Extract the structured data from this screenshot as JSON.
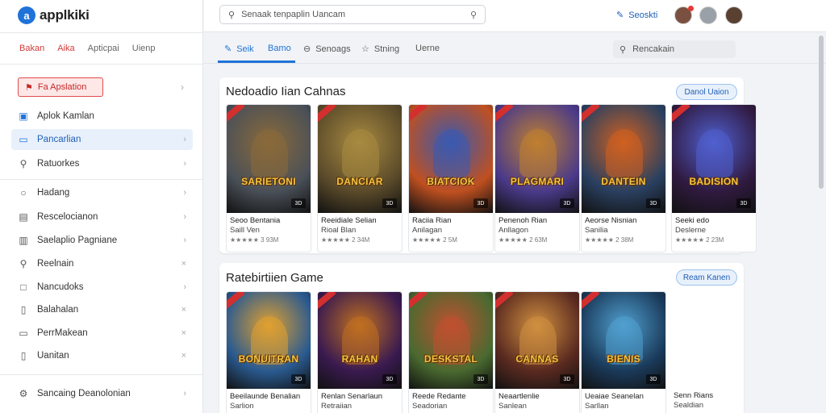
{
  "app": {
    "logo_text": "applkiki"
  },
  "sidebar": {
    "tabs": [
      "Bakan",
      "Aika",
      "Apticpai",
      "Uienp"
    ],
    "featured": {
      "label": "Fa Apslation"
    },
    "items": [
      {
        "label": "Aplok Kamlan",
        "icon": "app-window-icon"
      },
      {
        "label": "Pancarlian",
        "icon": "chat-bubble-icon"
      },
      {
        "label": "Ratuorkes",
        "icon": "search-icon"
      },
      {
        "label": "Hadang",
        "icon": "circle-icon"
      },
      {
        "label": "Rescelocianon",
        "icon": "calendar-icon"
      },
      {
        "label": "Saelaplio Pagniane",
        "icon": "sliders-icon"
      },
      {
        "label": "Reelnain",
        "icon": "magnifier-icon"
      },
      {
        "label": "Nancudoks",
        "icon": "square-icon"
      },
      {
        "label": "Balahalan",
        "icon": "bookmark-icon"
      },
      {
        "label": "PerrMakean",
        "icon": "folder-icon"
      },
      {
        "label": "Uanitan",
        "icon": "cube-icon"
      }
    ],
    "bottom_item": {
      "label": "Sancaing Deanolonian",
      "icon": "gear-icon"
    }
  },
  "topbar": {
    "search_text": "Senaak tenpaplin Uancam",
    "action_label": "Seoskti"
  },
  "content_tabs": [
    "Seik",
    "Bamo",
    "Senoags",
    "Stning",
    "Uerne"
  ],
  "sub_search": {
    "placeholder": "Rencakain"
  },
  "sections": [
    {
      "title": "Nedoadio Iian Cahnas",
      "button": "Danol Uaion",
      "cards": [
        {
          "cover_title": "SARIETONI",
          "name": "Seoo Bentania",
          "dev": "Saill Ven",
          "rating": "★★★★★ 3 93M",
          "badge": "3D",
          "bg": "#4a5058",
          "accent": "#8a6a3a"
        },
        {
          "cover_title": "DANCIAR",
          "name": "Reeidiale Selian",
          "dev": "Rioal Blan",
          "rating": "★★★★★ 2 34M",
          "badge": "3D",
          "bg": "#5a4a2a",
          "accent": "#a88a40"
        },
        {
          "cover_title": "BIATCIOK",
          "name": "Raciia Rian",
          "dev": "Anilagan",
          "rating": "★★★★★ 2 5M",
          "badge": "3D",
          "bg": "#c05020",
          "accent": "#3a5ab0"
        },
        {
          "cover_title": "PLAGMARI",
          "name": "Penenoh Rian",
          "dev": "Anllagon",
          "rating": "★★★★★ 2 63M",
          "badge": "3D",
          "bg": "#4a3a8a",
          "accent": "#c08030"
        },
        {
          "cover_title": "DANTEIN",
          "name": "Aeorse Nisnian",
          "dev": "Sanilia",
          "rating": "★★★★★ 2 38M",
          "badge": "3D",
          "bg": "#2a4060",
          "accent": "#d06020"
        },
        {
          "cover_title": "BADISION",
          "name": "Seeki edo",
          "dev": "Deslerne",
          "rating": "★★★★★ 2 23M",
          "badge": "3D",
          "bg": "#301a40",
          "accent": "#5060d0"
        }
      ]
    },
    {
      "title": "Ratebirtiien Game",
      "button": "Ream Kanen",
      "cards": [
        {
          "cover_title": "BONUITRAN",
          "name": "Beeilaunde Benalian",
          "dev": "Sarlion",
          "rating": "",
          "badge": "3D",
          "bg": "#2a5a90",
          "accent": "#e0a030"
        },
        {
          "cover_title": "RAHAN",
          "name": "Renlan Senarlaun",
          "dev": "Retraiian",
          "rating": "",
          "badge": "3D",
          "bg": "#3a1a50",
          "accent": "#c07020"
        },
        {
          "cover_title": "DESKSTAL",
          "name": "Reede Redante",
          "dev": "Seadorian",
          "rating": "",
          "badge": "3D",
          "bg": "#4a6a30",
          "accent": "#c05030"
        },
        {
          "cover_title": "CANNAS",
          "name": "Neaartlenlie",
          "dev": "Sanlean",
          "rating": "",
          "badge": "3D",
          "bg": "#5a2a20",
          "accent": "#d09040"
        },
        {
          "cover_title": "BIENIS",
          "name": "Ueaiae Seanelan",
          "dev": "Sarllan",
          "rating": "",
          "badge": "3D",
          "bg": "#1a3a5a",
          "accent": "#50a0d0"
        }
      ],
      "empty_card": {
        "name": "Senn Rians",
        "dev": "Sealdian"
      }
    }
  ]
}
